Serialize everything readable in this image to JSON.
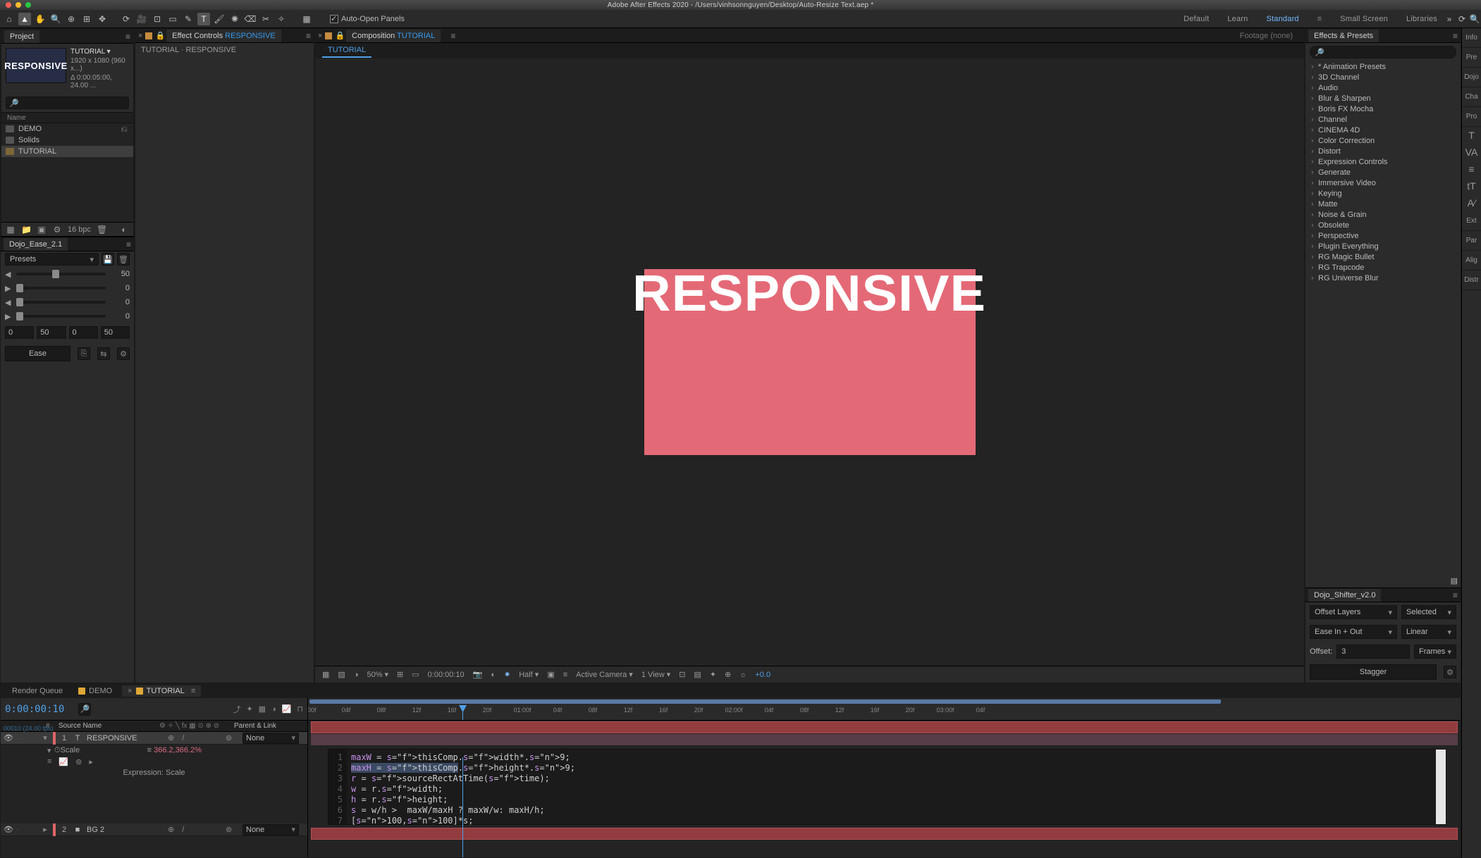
{
  "app": {
    "title": "Adobe After Effects 2020 - /Users/vinhsonnguyen/Desktop/Auto-Resize Text.aep *",
    "traffic": {
      "close": "#ff5f57",
      "min": "#febc2e",
      "max": "#28c840"
    }
  },
  "tools": [
    {
      "name": "home-icon",
      "glyph": "⌂"
    },
    {
      "name": "selection-icon",
      "glyph": "▲",
      "active": true
    },
    {
      "name": "hand-icon",
      "glyph": "✋"
    },
    {
      "name": "zoom-icon",
      "glyph": "🔍"
    },
    {
      "name": "orbit-icon",
      "glyph": "⊕"
    },
    {
      "name": "unified-icon",
      "glyph": "⊞"
    },
    {
      "name": "anchor-icon",
      "glyph": "✥"
    },
    {
      "name": "sep",
      "glyph": ""
    },
    {
      "name": "rotate-icon",
      "glyph": "⟳"
    },
    {
      "name": "cam-icon",
      "glyph": "🎥"
    },
    {
      "name": "pan-behind-icon",
      "glyph": "⊡"
    },
    {
      "name": "rect-icon",
      "glyph": "▭"
    },
    {
      "name": "pen-icon",
      "glyph": "✎"
    },
    {
      "name": "type-icon",
      "glyph": "T",
      "active": true
    },
    {
      "name": "brush-icon",
      "glyph": "🖌"
    },
    {
      "name": "clone-icon",
      "glyph": "✺"
    },
    {
      "name": "eraser-icon",
      "glyph": "⌫"
    },
    {
      "name": "roto-icon",
      "glyph": "✂"
    },
    {
      "name": "puppet-icon",
      "glyph": "✧"
    }
  ],
  "auto_open_panels": "Auto-Open Panels",
  "workspaces": [
    "Default",
    "Learn",
    "Standard",
    "Small Screen",
    "Libraries"
  ],
  "workspace_active": "Standard",
  "project": {
    "tab": "Project",
    "thumb_text": "RESPONSIVE",
    "comp_name": "TUTORIAL ▾",
    "comp_dim": "1920 x 1080 (960 x...)",
    "comp_dur": "Δ 0:00:05:00, 24.00 ...",
    "header": "Name",
    "items": [
      {
        "name": "DEMO",
        "kind": "folder",
        "flow": true
      },
      {
        "name": "Solids",
        "kind": "folder"
      },
      {
        "name": "TUTORIAL",
        "kind": "comp",
        "sel": true
      }
    ],
    "foot_bpc": "16 bpc",
    "search_ph": "🔎"
  },
  "fx": {
    "tab_pre": "Effect Controls ",
    "tab_layer": "RESPONSIVE",
    "breadcrumb": "TUTORIAL · RESPONSIVE"
  },
  "viewer": {
    "tab_pre": "Composition ",
    "tab_comp": "TUTORIAL",
    "tab_footage": "Footage (none)",
    "mini_tab": "TUTORIAL",
    "hero_text": "RESPONSIVE",
    "zoom": "50%",
    "time": "0:00:00:10",
    "res": "Half",
    "camera": "Active Camera",
    "view": "1 View",
    "expo_bias": "+0.0"
  },
  "effects_presets": {
    "tab": "Effects & Presets",
    "search_ph": "🔎",
    "tree": [
      "* Animation Presets",
      "3D Channel",
      "Audio",
      "Blur & Sharpen",
      "Boris FX Mocha",
      "Channel",
      "CINEMA 4D",
      "Color Correction",
      "Distort",
      "Expression Controls",
      "Generate",
      "Immersive Video",
      "Keying",
      "Matte",
      "Noise & Grain",
      "Obsolete",
      "Perspective",
      "Plugin Everything",
      "RG Magic Bullet",
      "RG Trapcode",
      "RG Universe Blur"
    ]
  },
  "strip_tabs": [
    "Info",
    "Pre",
    "Dojo",
    "Cha",
    "Pro",
    "Ext",
    "Par",
    "Alig",
    "Distr"
  ],
  "dojo_ease": {
    "title": "Dojo_Ease_2.1",
    "presets_label": "Presets",
    "sliders": [
      50,
      0,
      0,
      0
    ],
    "mini": [
      "0",
      "50",
      "0",
      "50"
    ],
    "ease_btn": "Ease"
  },
  "dojo_shifter": {
    "title": "Dojo_Shifter_v2.0",
    "mode": "Offset Layers",
    "scope": "Selected",
    "ease": "Ease In + Out",
    "curve": "Linear",
    "offset_label": "Offset:",
    "offset_val": "3",
    "offset_unit": "Frames",
    "stagger": "Stagger"
  },
  "timeline": {
    "tabs": [
      {
        "label": "Render Queue",
        "color": null
      },
      {
        "label": "DEMO",
        "color": "#e0a837"
      },
      {
        "label": "TUTORIAL",
        "color": "#e0a837",
        "active": true
      }
    ],
    "time": "0:00:00:10",
    "frames_sub": "00010 (24.00 fps)",
    "cols": {
      "src": "Source Name",
      "parent": "Parent & Link"
    },
    "layers": [
      {
        "idx": 1,
        "name": "RESPONSIVE",
        "type": "T",
        "color": "#d66",
        "parent": "None",
        "sel": true,
        "prop": {
          "name": "Scale",
          "value": "366.2,366.2%",
          "expr_label": "Expression: Scale",
          "code": [
            "maxW = thisComp.width*.9;",
            "maxH = thisComp.height*.9;",
            "r = sourceRectAtTime(time);",
            "w = r.width;",
            "h = r.height;",
            "s = w/h >  maxW/maxH ? maxW/w: maxH/h;",
            "[100,100]*s;"
          ],
          "sel_line": 2
        }
      },
      {
        "idx": 2,
        "name": "BG 2",
        "type": "■",
        "color": "#d66",
        "parent": "None"
      }
    ],
    "ruler_ticks": [
      ":00f",
      "04f",
      "08f",
      "12f",
      "16f",
      "20f",
      "01:00f",
      "04f",
      "08f",
      "12f",
      "16f",
      "20f",
      "02:00f",
      "04f",
      "08f",
      "12f",
      "16f",
      "20f",
      "03:00f",
      "04f"
    ],
    "playhead_pct": 13.4
  }
}
